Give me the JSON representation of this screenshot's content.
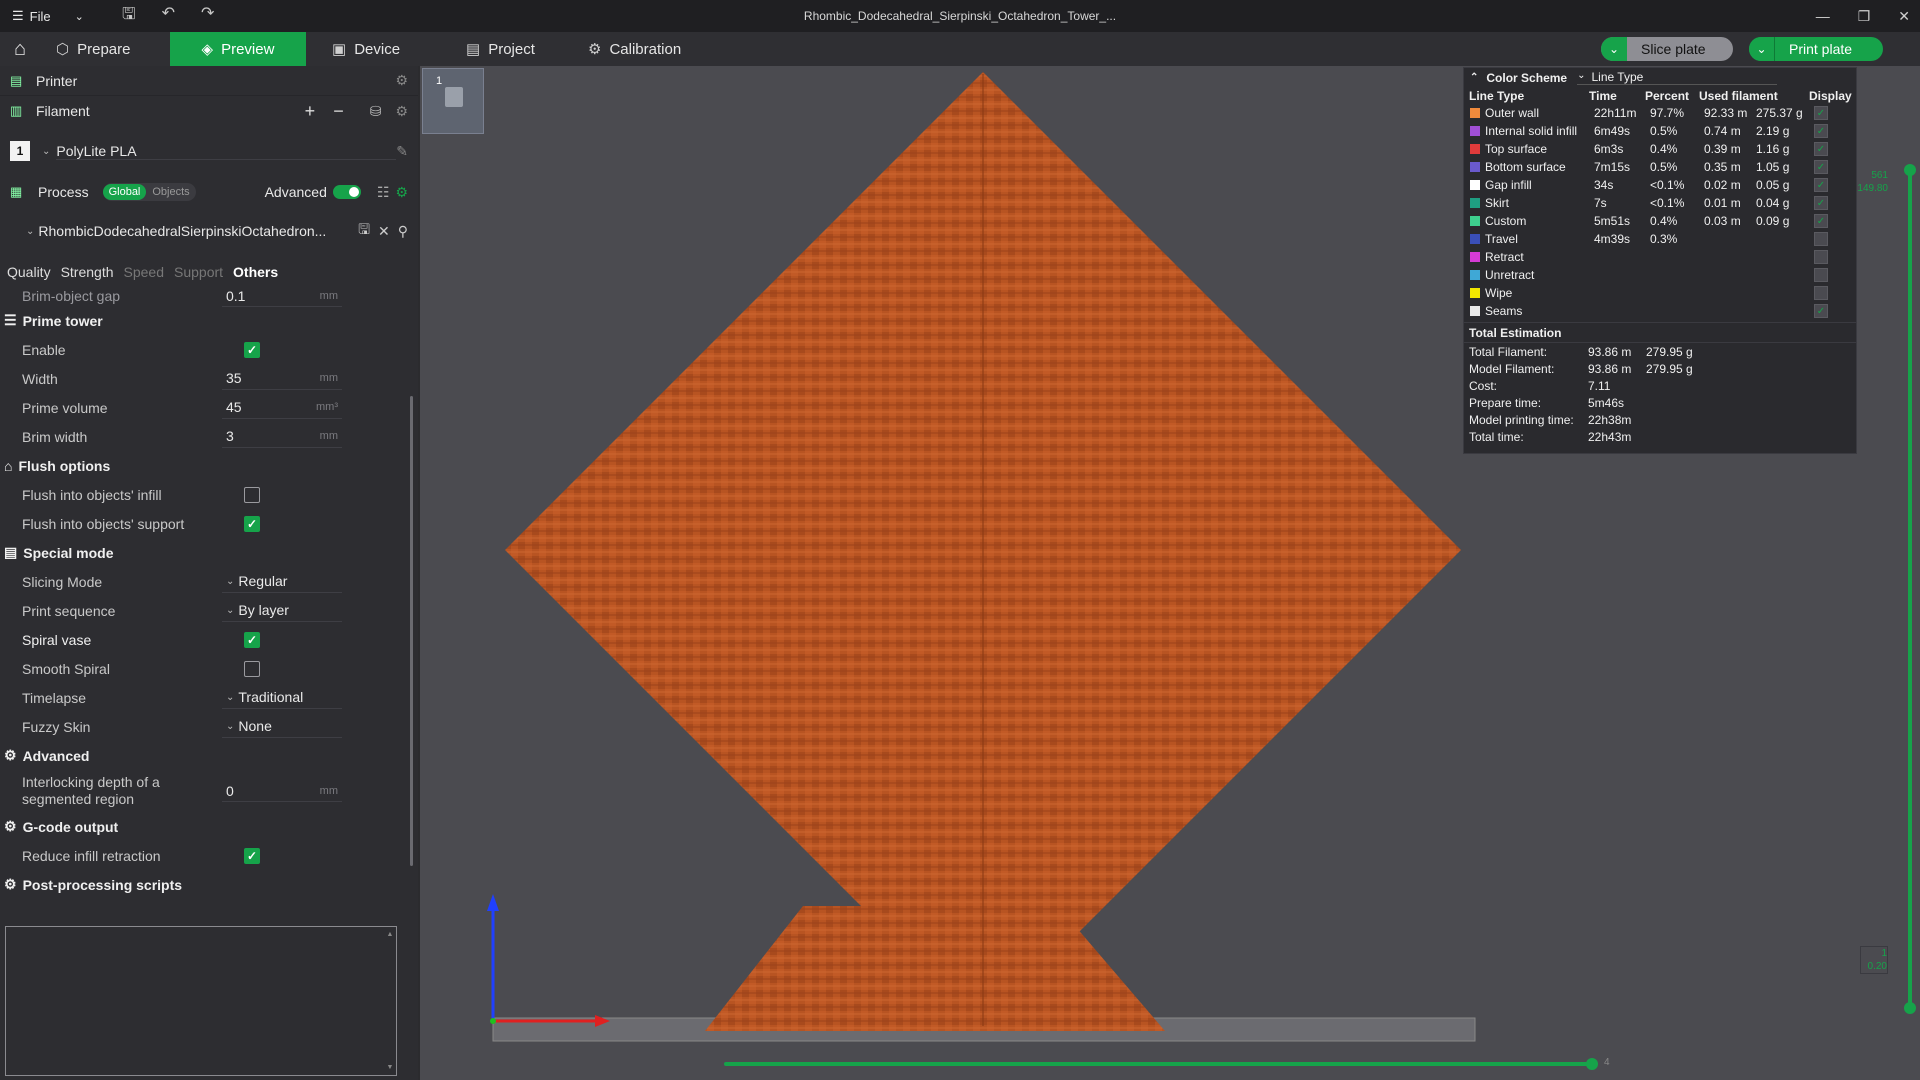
{
  "titlebar": {
    "file_label": "File",
    "window_title": "Rhombic_Dodecahedral_Sierpinski_Octahedron_Tower_..."
  },
  "tabs": [
    {
      "label": "Prepare",
      "icon": "cube-icon"
    },
    {
      "label": "Preview",
      "icon": "layers-icon"
    },
    {
      "label": "Device",
      "icon": "device-icon"
    },
    {
      "label": "Project",
      "icon": "project-icon"
    },
    {
      "label": "Calibration",
      "icon": "calibration-icon"
    }
  ],
  "actions": {
    "slice": "Slice plate",
    "print": "Print plate"
  },
  "sidebar": {
    "printer_label": "Printer",
    "filament_label": "Filament",
    "filament_index": "1",
    "filament_name": "PolyLite PLA",
    "process_label": "Process",
    "process_global": "Global",
    "process_objects": "Objects",
    "advanced_label": "Advanced",
    "object_name": "RhombicDodecahedralSierpinskiOctahedron...",
    "subtabs": [
      "Quality",
      "Strength",
      "Speed",
      "Support",
      "Others"
    ],
    "brim_gap_label": "Brim-object gap",
    "brim_gap_value": "0.1",
    "unit_mm": "mm",
    "unit_mm3": "mm³",
    "sections": {
      "prime_tower": "Prime tower",
      "flush": "Flush options",
      "special": "Special mode",
      "advanced": "Advanced",
      "gcode": "G-code output",
      "post": "Post-processing scripts"
    },
    "prime_tower": {
      "enable_label": "Enable",
      "width_label": "Width",
      "width_value": "35",
      "volume_label": "Prime volume",
      "volume_value": "45",
      "brim_label": "Brim width",
      "brim_value": "3"
    },
    "flush": {
      "infill_label": "Flush into objects' infill",
      "support_label": "Flush into objects' support"
    },
    "special": {
      "slicing_label": "Slicing Mode",
      "slicing_value": "Regular",
      "sequence_label": "Print sequence",
      "sequence_value": "By layer",
      "spiral_label": "Spiral vase",
      "smooth_label": "Smooth Spiral",
      "timelapse_label": "Timelapse",
      "timelapse_value": "Traditional",
      "fuzzy_label": "Fuzzy Skin",
      "fuzzy_value": "None"
    },
    "advanced_sec": {
      "interlock_label_1": "Interlocking depth of a",
      "interlock_label_2": "segmented region",
      "interlock_value": "0"
    },
    "gcode": {
      "reduce_label": "Reduce infill retraction"
    }
  },
  "plate_thumb_number": "1",
  "legend": {
    "title": "Color Scheme",
    "scheme": "Line Type",
    "headers": [
      "Line Type",
      "Time",
      "Percent",
      "Used filament",
      "Display"
    ],
    "rows": [
      {
        "name": "Outer wall",
        "color": "#f08a3c",
        "time": "22h11m",
        "pct": "97.7%",
        "len": "92.33 m",
        "wt": "275.37 g",
        "on": true
      },
      {
        "name": "Internal solid infill",
        "color": "#a04fd6",
        "time": "6m49s",
        "pct": "0.5%",
        "len": "0.74 m",
        "wt": "2.19 g",
        "on": true
      },
      {
        "name": "Top surface",
        "color": "#e03b3b",
        "time": "6m3s",
        "pct": "0.4%",
        "len": "0.39 m",
        "wt": "1.16 g",
        "on": true
      },
      {
        "name": "Bottom surface",
        "color": "#6a5acd",
        "time": "7m15s",
        "pct": "0.5%",
        "len": "0.35 m",
        "wt": "1.05 g",
        "on": true
      },
      {
        "name": "Gap infill",
        "color": "#ffffff",
        "time": "34s",
        "pct": "<0.1%",
        "len": "0.02 m",
        "wt": "0.05 g",
        "on": true
      },
      {
        "name": "Skirt",
        "color": "#1f9e82",
        "time": "7s",
        "pct": "<0.1%",
        "len": "0.01 m",
        "wt": "0.04 g",
        "on": true
      },
      {
        "name": "Custom",
        "color": "#3ecf8e",
        "time": "5m51s",
        "pct": "0.4%",
        "len": "0.03 m",
        "wt": "0.09 g",
        "on": true
      },
      {
        "name": "Travel",
        "color": "#3a4fb8",
        "time": "4m39s",
        "pct": "0.3%",
        "len": "",
        "wt": "",
        "on": false
      },
      {
        "name": "Retract",
        "color": "#d63bd6",
        "time": "",
        "pct": "",
        "len": "",
        "wt": "",
        "on": false
      },
      {
        "name": "Unretract",
        "color": "#3fa8d6",
        "time": "",
        "pct": "",
        "len": "",
        "wt": "",
        "on": false
      },
      {
        "name": "Wipe",
        "color": "#f2e600",
        "time": "",
        "pct": "",
        "len": "",
        "wt": "",
        "on": false
      },
      {
        "name": "Seams",
        "color": "#e8e8e8",
        "time": "",
        "pct": "",
        "len": "",
        "wt": "",
        "on": true
      }
    ],
    "estimation_title": "Total Estimation",
    "estimation": [
      {
        "label": "Total Filament:",
        "v1": "93.86 m",
        "v2": "279.95 g"
      },
      {
        "label": "Model Filament:",
        "v1": "93.86 m",
        "v2": "279.95 g"
      },
      {
        "label": "Cost:",
        "v1": "7.11",
        "v2": ""
      },
      {
        "label": "Prepare time:",
        "v1": "5m46s",
        "v2": ""
      },
      {
        "label": "Model printing time:",
        "v1": "22h38m",
        "v2": ""
      },
      {
        "label": "Total time:",
        "v1": "22h43m",
        "v2": ""
      }
    ]
  },
  "layer_slider": {
    "top_layer": "561",
    "top_height": "149.80",
    "bottom_layer": "1",
    "bottom_height": "0.20"
  },
  "move_slider": {
    "end_value": "4"
  },
  "colors": {
    "accent": "#16a34a",
    "model": "#b85422"
  }
}
